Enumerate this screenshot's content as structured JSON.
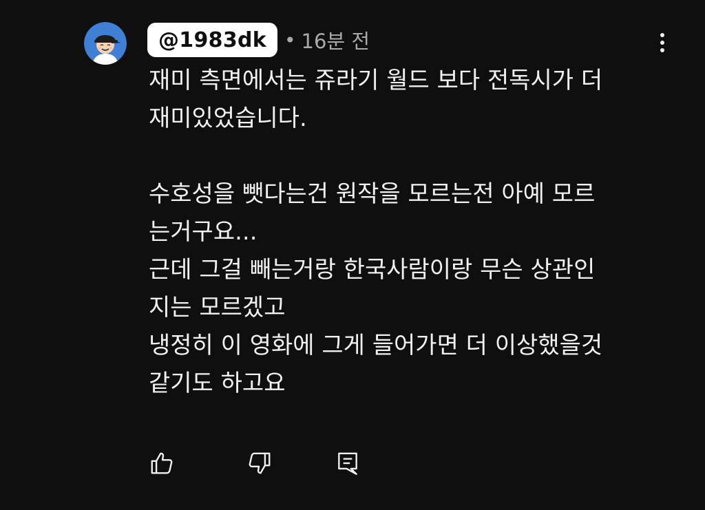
{
  "comment": {
    "author": {
      "handle": "@1983dk",
      "avatar_icon": "cartoon-avatar-with-cap"
    },
    "separator": "•",
    "timestamp": "16분 전",
    "body_lines": [
      "재미 측면에서는 쥬라기 월드 보다 전독시가 더",
      "재미있었습니다.",
      "",
      "수호성을 뺏다는건 원작을 모르는전 아예 모르",
      "는거구요...",
      "근데 그걸 빼는거랑 한국사람이랑 무슨 상관인",
      "지는 모르겠고",
      "냉정히 이 영화에 그게 들어가면 더 이상했을것",
      "같기도 하고요"
    ]
  },
  "actions": {
    "like_icon": "thumbs-up-icon",
    "dislike_icon": "thumbs-down-icon",
    "reply_icon": "reply-comment-icon",
    "more_icon": "more-vertical-icon"
  },
  "colors": {
    "background": "#0f0f0f",
    "text": "#f1f1f1",
    "secondary_text": "#aaaaaa",
    "chip_background": "#ffffff"
  }
}
